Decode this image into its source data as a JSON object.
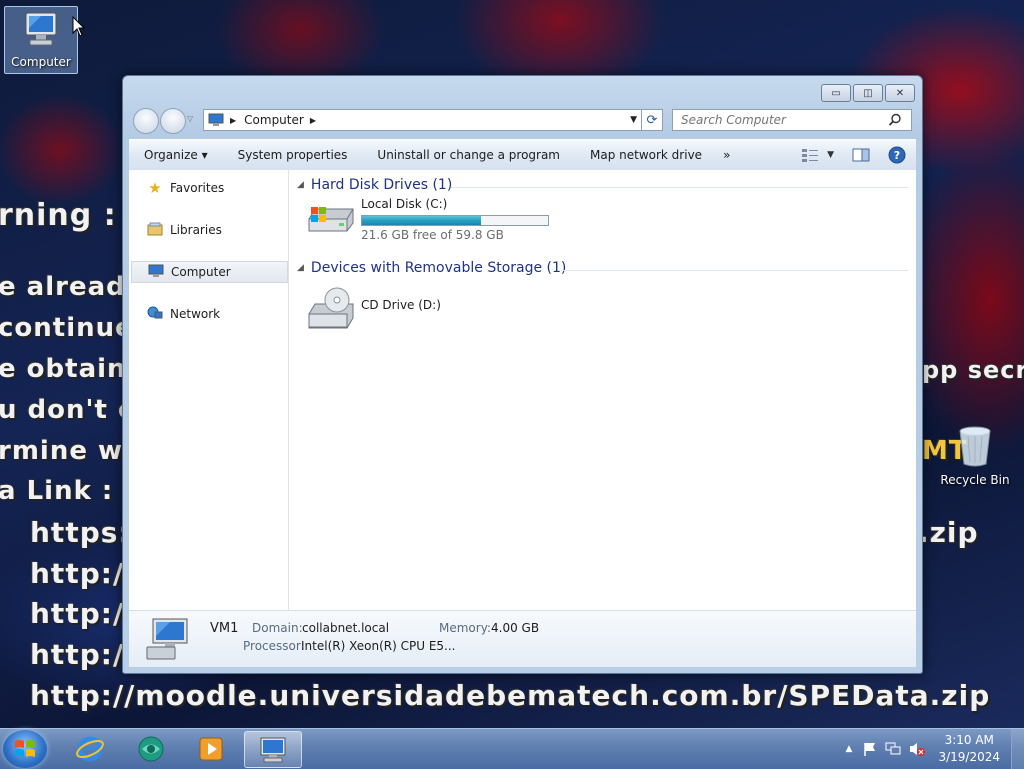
{
  "desktop": {
    "icons": [
      {
        "label": "Computer"
      },
      {
        "label": "Recycle Bin"
      }
    ],
    "wallpaper_text": [
      "rning :",
      "e alread",
      "continue",
      "e obtain",
      "u don't c",
      "rmine w",
      "a Link :",
      "https:",
      "http:/",
      "http:/",
      "http:/",
      "http://moodle.universidadebematech.com.br/SPEData.zip",
      "pp secr",
      "MT",
      ".zip"
    ]
  },
  "window": {
    "controls": {
      "minimize": "▭",
      "restore": "◫",
      "close": "✕"
    },
    "address": {
      "location_icon": "computer-icon",
      "crumb": "Computer"
    },
    "search": {
      "placeholder": "Search Computer"
    },
    "toolbar": {
      "organize": "Organize ▾",
      "system_properties": "System properties",
      "uninstall": "Uninstall or change a program",
      "map_drive": "Map network drive",
      "more": "»"
    },
    "nav": [
      {
        "label": "Favorites",
        "icon": "star-icon"
      },
      {
        "label": "Libraries",
        "icon": "libraries-icon"
      },
      {
        "label": "Computer",
        "icon": "computer-icon"
      },
      {
        "label": "Network",
        "icon": "network-icon"
      }
    ],
    "groups": {
      "hdd": {
        "header": "Hard Disk Drives (1)",
        "drive": {
          "name": "Local Disk (C:)",
          "free_text": "21.6 GB free of 59.8 GB",
          "used_fraction": 0.639
        }
      },
      "removable": {
        "header": "Devices with Removable Storage (1)",
        "drive": {
          "name": "CD Drive (D:)"
        }
      }
    },
    "details": {
      "name": "VM1",
      "domain_label": "Domain:",
      "domain_value": "collabnet.local",
      "memory_label": "Memory:",
      "memory_value": "4.00 GB",
      "processor_label": "Processor:",
      "processor_value": "Intel(R) Xeon(R) CPU E5..."
    }
  },
  "taskbar": {
    "apps": [
      "internet-explorer-icon",
      "browser-icon",
      "media-player-icon",
      "explorer-computer-icon"
    ],
    "tray": {
      "time": "3:10 AM",
      "date": "3/19/2024",
      "show_hidden": "▲"
    }
  },
  "colors": {
    "group_header": "#1e3287",
    "bar_fill": "#27a0c2"
  }
}
